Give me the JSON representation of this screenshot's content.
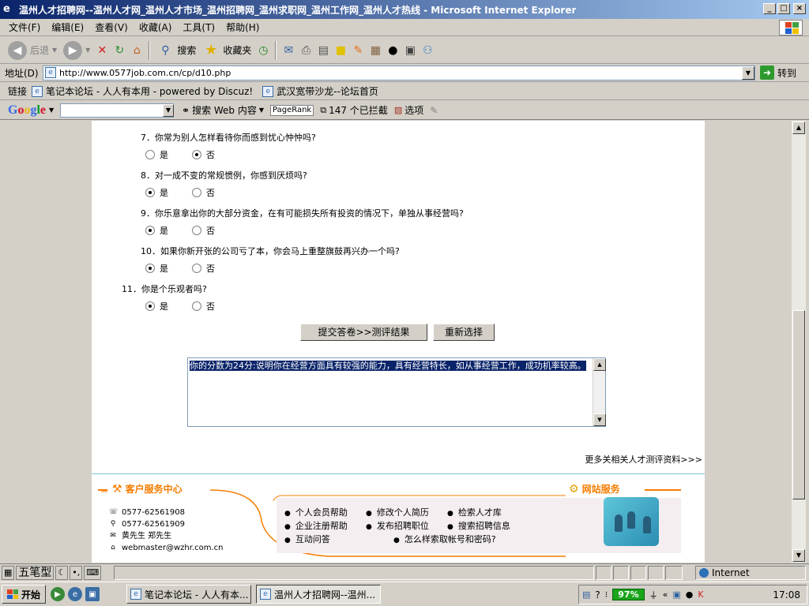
{
  "window": {
    "title": "温州人才招聘网--温州人才网_温州人才市场_温州招聘网_温州求职网_温州工作网_温州人才热线 - Microsoft Internet Explorer"
  },
  "menu": [
    "文件(F)",
    "编辑(E)",
    "查看(V)",
    "收藏(A)",
    "工具(T)",
    "帮助(H)"
  ],
  "toolbar": {
    "back": "后退",
    "search": "搜索",
    "favorites": "收藏夹"
  },
  "address": {
    "label": "地址(D)",
    "url": "http://www.0577job.com.cn/cp/d10.php",
    "go": "转到"
  },
  "links": {
    "label": "链接",
    "items": [
      "笔记本论坛 - 人人有本用 - powered by Discuz!",
      "武汉宽带沙龙--论坛首页"
    ]
  },
  "google": {
    "search_web": "搜索 Web 内容",
    "pagerank": "PageRank",
    "blocked": "147 个已拦截",
    "options": "选项"
  },
  "quiz": {
    "questions": [
      {
        "text": "7．你常为别人怎样看待你而感到忧心忡忡吗?",
        "selected": "否"
      },
      {
        "text": "8．对一成不变的常规惯例，你感到厌烦吗?",
        "selected": "是"
      },
      {
        "text": "9．你乐意拿出你的大部分资金，在有可能损失所有投资的情况下，单独从事经营吗?",
        "selected": "是"
      },
      {
        "text": "10．如果你新开张的公司亏了本，你会马上重整旗鼓再兴办一个吗?",
        "selected": "是"
      },
      {
        "text": "11．你是个乐观者吗?",
        "selected": "是"
      }
    ],
    "yes": "是",
    "no": "否",
    "submit": "提交答卷>>测评结果",
    "reset": "重新选择",
    "result": "你的分数为24分:说明你在经营方面具有较强的能力，具有经营特长，如从事经营工作，成功机率较高。",
    "more": "更多关相关人才测评资料>>>"
  },
  "footer": {
    "customer_center": "客户服务中心",
    "site_service": "网站服务",
    "phone": "0577-62561908",
    "fax": "0577-62561909",
    "contact_names": "黄先生 郑先生",
    "email": "webmaster@wzhr.com.cn",
    "service_links": [
      [
        "个人会员帮助",
        "修改个人简历",
        "检索人才库"
      ],
      [
        "企业注册帮助",
        "发布招聘职位",
        "搜索招聘信息"
      ],
      [
        "互动问答",
        "怎么样索取帐号和密码?"
      ]
    ]
  },
  "statusbar": {
    "ime_name": "五笔型",
    "zone": "Internet"
  },
  "taskbar": {
    "start": "开始",
    "tasks": [
      "笔记本论坛 - 人人有本...",
      "温州人才招聘网--温州..."
    ],
    "battery": "97%",
    "clock": "17:08"
  }
}
